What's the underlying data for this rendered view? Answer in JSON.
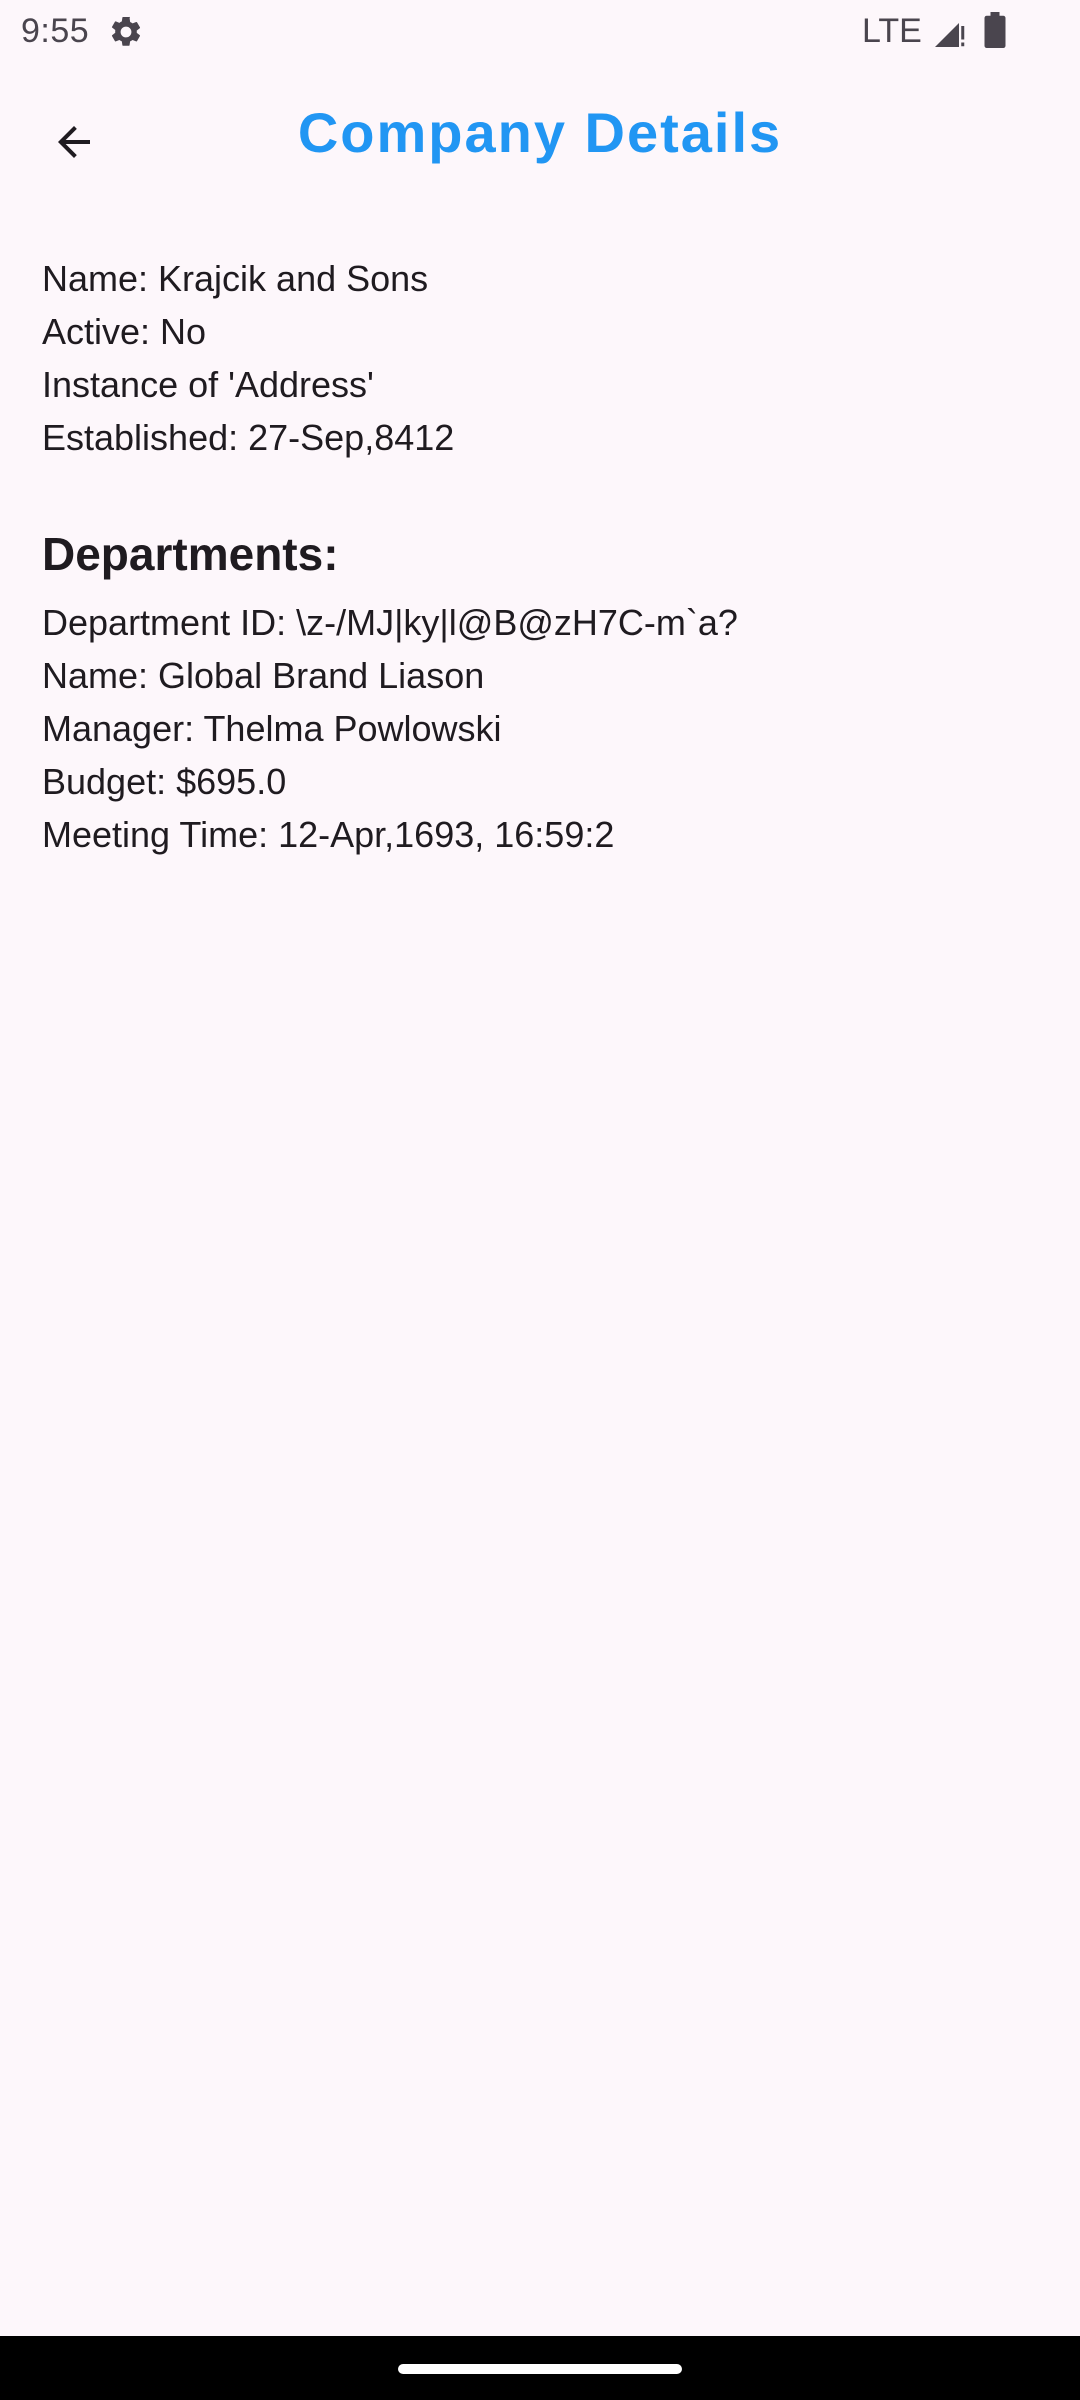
{
  "status_bar": {
    "time": "9:55",
    "network": "LTE",
    "icons": [
      "gear-icon",
      "signal-icon",
      "battery-icon"
    ]
  },
  "app_bar": {
    "title": "Company Details",
    "back_icon": "arrow-back-icon",
    "title_color": "#2196f3"
  },
  "company": {
    "name_line": "Name: Krajcik and Sons",
    "active_line": "Active: No",
    "instance_line": "Instance of 'Address'",
    "established_line": "Established: 27-Sep,8412"
  },
  "departments": {
    "heading": "Departments:",
    "items": [
      {
        "id_line": "Department ID: \\z-/MJ|ky|l@B@zH7C-m`a?",
        "name_line": "Name: Global Brand Liason",
        "manager_line": "Manager: Thelma Powlowski",
        "budget_line": "Budget: $695.0",
        "meeting_line": "Meeting Time: 12-Apr,1693, 16:59:2"
      }
    ]
  }
}
